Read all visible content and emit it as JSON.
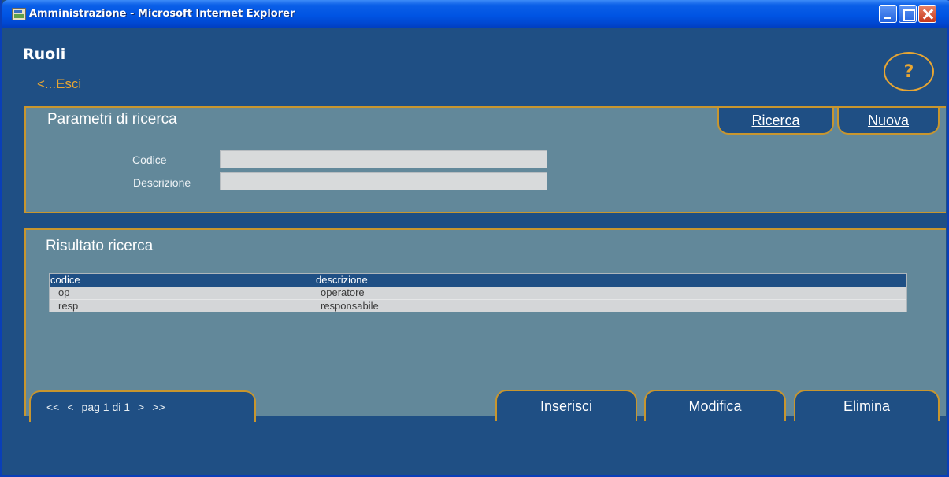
{
  "window": {
    "title": "Amministrazione - Microsoft Internet Explorer",
    "controls": [
      "minimize",
      "maximize",
      "close"
    ]
  },
  "header": {
    "title": "Ruoli",
    "exit_link": "<...Esci",
    "help_label": "?"
  },
  "search_panel": {
    "title": "Parametri di ricerca",
    "tabs": [
      {
        "label": "Ricerca"
      },
      {
        "label": "Nuova"
      }
    ],
    "fields": [
      {
        "label": "Codice",
        "value": ""
      },
      {
        "label": "Descrizione",
        "value": ""
      }
    ]
  },
  "results_panel": {
    "title": "Risultato ricerca",
    "columns": [
      "codice",
      "descrizione"
    ],
    "rows": [
      [
        "op",
        "operatore"
      ],
      [
        "resp",
        "responsabile"
      ]
    ],
    "pager": {
      "first": "<<",
      "prev": "<",
      "label": "pag 1 di 1",
      "next": ">",
      "last": ">>"
    },
    "actions": [
      {
        "label": "Inserisci"
      },
      {
        "label": "Modifica"
      },
      {
        "label": "Elimina"
      }
    ]
  },
  "colors": {
    "background": "#1f4f84",
    "panel": "#62889a",
    "accent": "#c8962e",
    "link": "#e8a633"
  },
  "icons": {
    "app": "ie-page-icon",
    "help": "help-circle-icon"
  }
}
